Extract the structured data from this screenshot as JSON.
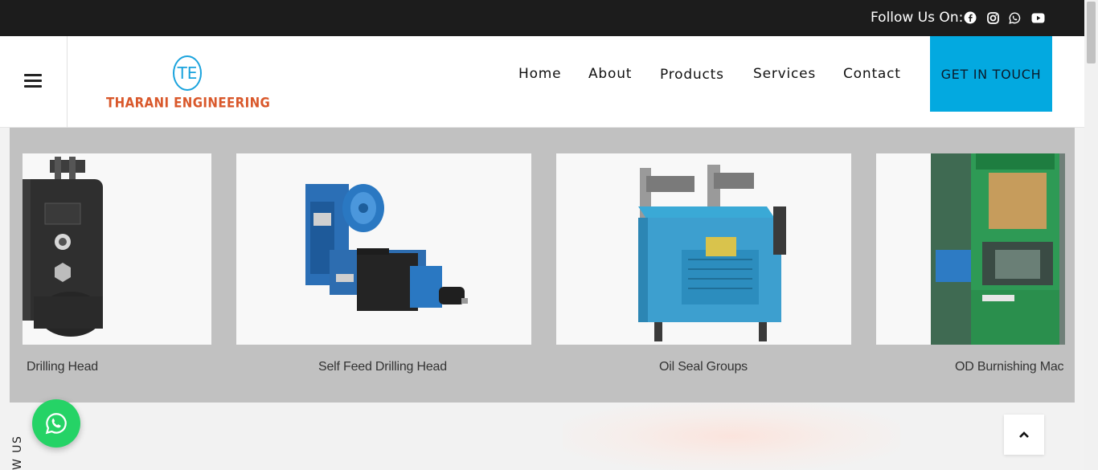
{
  "topbar": {
    "follow_label": "Follow Us On:",
    "social_icons": [
      "facebook-icon",
      "instagram-icon",
      "whatsapp-icon",
      "youtube-icon"
    ]
  },
  "header": {
    "logo": {
      "monogram": "TE",
      "name": "THARANI ENGINEERING",
      "monogram_color": "#1aa3dd",
      "name_color": "#d9582b"
    },
    "nav": [
      "Home",
      "About",
      "Products",
      "Services",
      "Contact"
    ],
    "cta_label": "GET IN TOUCH",
    "cta_color": "#03a9e0"
  },
  "products": [
    {
      "caption": "Drilling Head"
    },
    {
      "caption": "Self Feed Drilling Head"
    },
    {
      "caption": "Oil Seal Groups"
    },
    {
      "caption": "OD Burnishing Mac"
    }
  ],
  "side_text": "W US",
  "colors": {
    "carousel_bg": "#c1c1c1",
    "whatsapp": "#25d366",
    "topbar": "#1c1c1c"
  }
}
